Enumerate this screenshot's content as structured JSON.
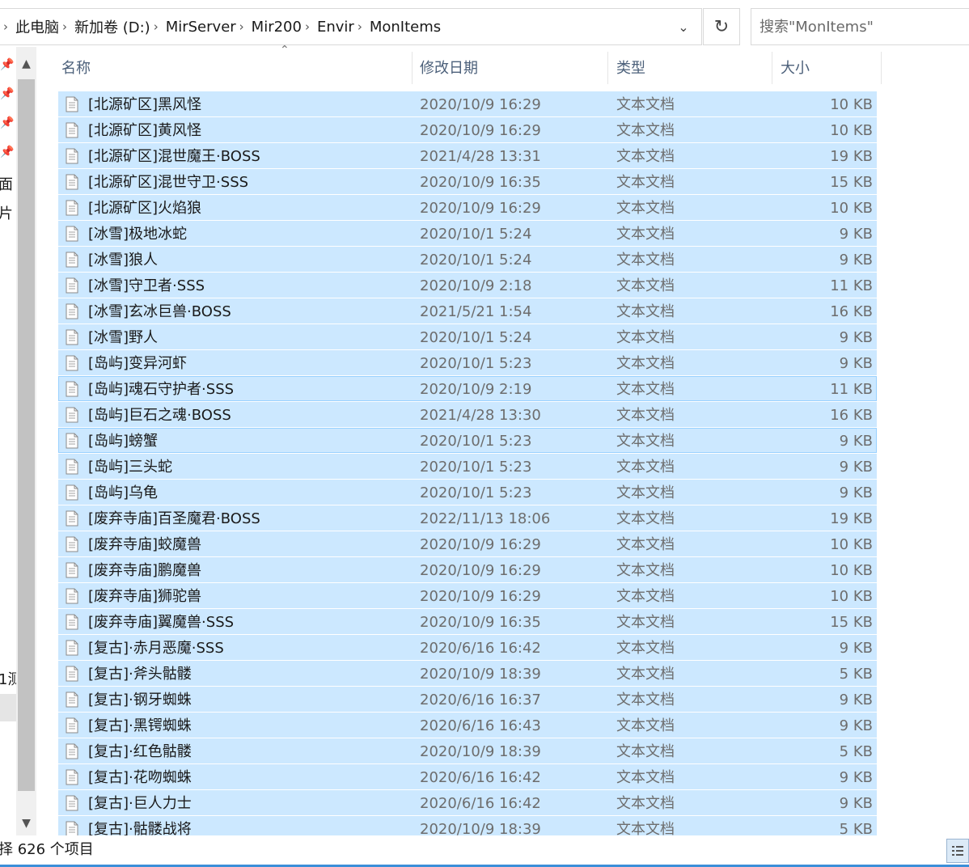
{
  "address_bar": {
    "breadcrumbs": [
      "此电脑",
      "新加卷 (D:)",
      "MirServer",
      "Mir200",
      "Envir",
      "MonItems"
    ]
  },
  "search": {
    "placeholder": "搜索\"MonItems\""
  },
  "nav_pane": {
    "visible_fragments": [
      "面",
      "片",
      "1测"
    ]
  },
  "columns": {
    "name": "名称",
    "date": "修改日期",
    "type": "类型",
    "size": "大小"
  },
  "files": [
    {
      "name": "[北源矿区]黑风怪",
      "date": "2020/10/9 16:29",
      "type": "文本文档",
      "size": "10 KB"
    },
    {
      "name": "[北源矿区]黄风怪",
      "date": "2020/10/9 16:29",
      "type": "文本文档",
      "size": "10 KB"
    },
    {
      "name": "[北源矿区]混世魔王·BOSS",
      "date": "2021/4/28 13:31",
      "type": "文本文档",
      "size": "19 KB"
    },
    {
      "name": "[北源矿区]混世守卫·SSS",
      "date": "2020/10/9 16:35",
      "type": "文本文档",
      "size": "15 KB"
    },
    {
      "name": "[北源矿区]火焰狼",
      "date": "2020/10/9 16:29",
      "type": "文本文档",
      "size": "10 KB"
    },
    {
      "name": "[冰雪]极地冰蛇",
      "date": "2020/10/1 5:24",
      "type": "文本文档",
      "size": "9 KB"
    },
    {
      "name": "[冰雪]狼人",
      "date": "2020/10/1 5:24",
      "type": "文本文档",
      "size": "9 KB"
    },
    {
      "name": "[冰雪]守卫者·SSS",
      "date": "2020/10/9 2:18",
      "type": "文本文档",
      "size": "11 KB"
    },
    {
      "name": "[冰雪]玄冰巨兽·BOSS",
      "date": "2021/5/21 1:54",
      "type": "文本文档",
      "size": "16 KB"
    },
    {
      "name": "[冰雪]野人",
      "date": "2020/10/1 5:24",
      "type": "文本文档",
      "size": "9 KB"
    },
    {
      "name": "[岛屿]变异河虾",
      "date": "2020/10/1 5:23",
      "type": "文本文档",
      "size": "9 KB"
    },
    {
      "name": "[岛屿]魂石守护者·SSS",
      "date": "2020/10/9 2:19",
      "type": "文本文档",
      "size": "11 KB"
    },
    {
      "name": "[岛屿]巨石之魂·BOSS",
      "date": "2021/4/28 13:30",
      "type": "文本文档",
      "size": "16 KB"
    },
    {
      "name": "[岛屿]螃蟹",
      "date": "2020/10/1 5:23",
      "type": "文本文档",
      "size": "9 KB"
    },
    {
      "name": "[岛屿]三头蛇",
      "date": "2020/10/1 5:23",
      "type": "文本文档",
      "size": "9 KB"
    },
    {
      "name": "[岛屿]乌龟",
      "date": "2020/10/1 5:23",
      "type": "文本文档",
      "size": "9 KB"
    },
    {
      "name": "[废弃寺庙]百圣魔君·BOSS",
      "date": "2022/11/13 18:06",
      "type": "文本文档",
      "size": "19 KB"
    },
    {
      "name": "[废弃寺庙]蛟魔兽",
      "date": "2020/10/9 16:29",
      "type": "文本文档",
      "size": "10 KB"
    },
    {
      "name": "[废弃寺庙]鹏魔兽",
      "date": "2020/10/9 16:29",
      "type": "文本文档",
      "size": "10 KB"
    },
    {
      "name": "[废弃寺庙]狮驼兽",
      "date": "2020/10/9 16:29",
      "type": "文本文档",
      "size": "10 KB"
    },
    {
      "name": "[废弃寺庙]翼魔兽·SSS",
      "date": "2020/10/9 16:35",
      "type": "文本文档",
      "size": "15 KB"
    },
    {
      "name": "[复古]·赤月恶魔·SSS",
      "date": "2020/6/16 16:42",
      "type": "文本文档",
      "size": "9 KB"
    },
    {
      "name": "[复古]·斧头骷髅",
      "date": "2020/10/9 18:39",
      "type": "文本文档",
      "size": "5 KB"
    },
    {
      "name": "[复古]·钢牙蜘蛛",
      "date": "2020/6/16 16:37",
      "type": "文本文档",
      "size": "9 KB"
    },
    {
      "name": "[复古]·黑锷蜘蛛",
      "date": "2020/6/16 16:43",
      "type": "文本文档",
      "size": "9 KB"
    },
    {
      "name": "[复古]·红色骷髅",
      "date": "2020/10/9 18:39",
      "type": "文本文档",
      "size": "5 KB"
    },
    {
      "name": "[复古]·花吻蜘蛛",
      "date": "2020/6/16 16:42",
      "type": "文本文档",
      "size": "9 KB"
    },
    {
      "name": "[复古]·巨人力士",
      "date": "2020/6/16 16:42",
      "type": "文本文档",
      "size": "9 KB"
    },
    {
      "name": "[复古]·骷髅战将",
      "date": "2020/10/9 18:39",
      "type": "文本文档",
      "size": "5 KB"
    }
  ],
  "status_bar": {
    "text": "择 626 个项目"
  },
  "colors": {
    "selection_bg": "#cce8ff",
    "focus_border": "#99d1ff",
    "header_text": "#4c607a"
  }
}
